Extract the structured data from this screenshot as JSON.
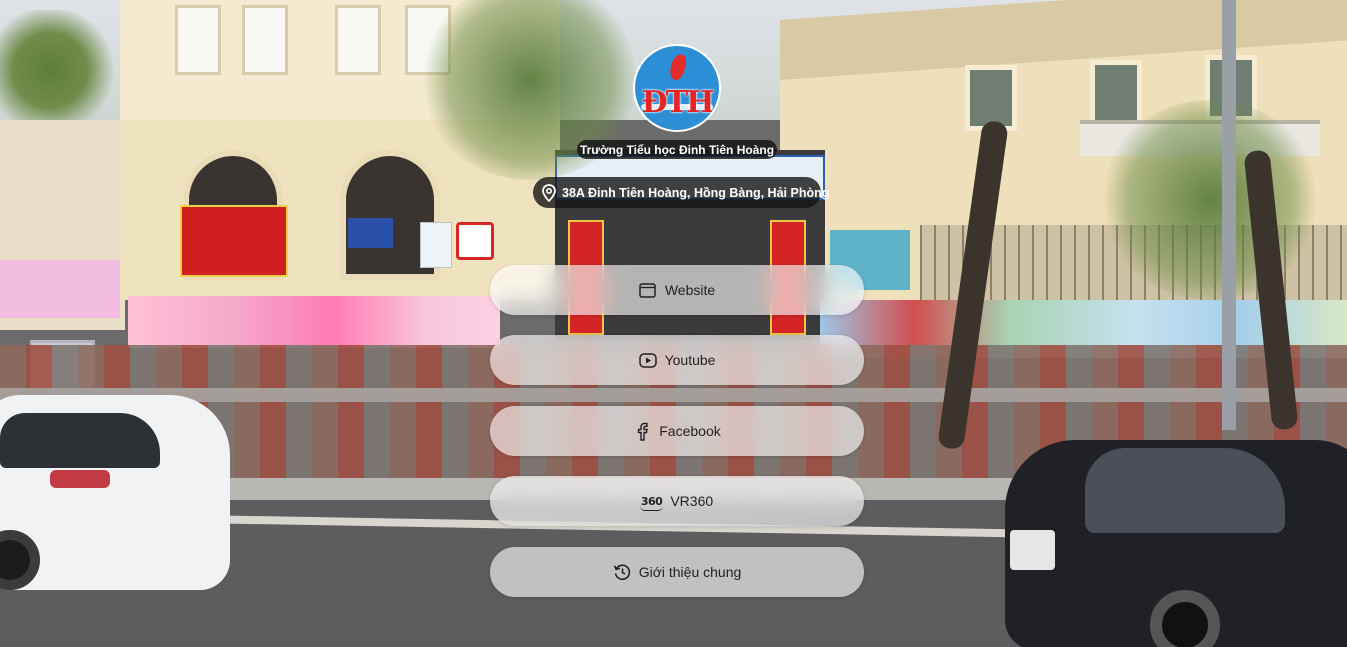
{
  "header": {
    "school_name": "Trường Tiểu học Đinh Tiên Hoàng",
    "address": "38A Đinh Tiên Hoàng, Hồng Bàng, Hải Phòng",
    "logo_text": "ĐTH"
  },
  "menu": [
    {
      "label": "Website",
      "icon": "browser-window-icon"
    },
    {
      "label": "Youtube",
      "icon": "youtube-play-icon"
    },
    {
      "label": "Facebook",
      "icon": "facebook-icon"
    },
    {
      "label": "VR360",
      "icon": "vr360-icon",
      "icon_text": "360"
    },
    {
      "label": "Giới thiệu chung",
      "icon": "history-icon"
    }
  ],
  "colors": {
    "logo_blue": "#2c8fd6",
    "logo_red": "#e52424",
    "pill_dark": "#141414",
    "button_bg": "#ffffff"
  }
}
